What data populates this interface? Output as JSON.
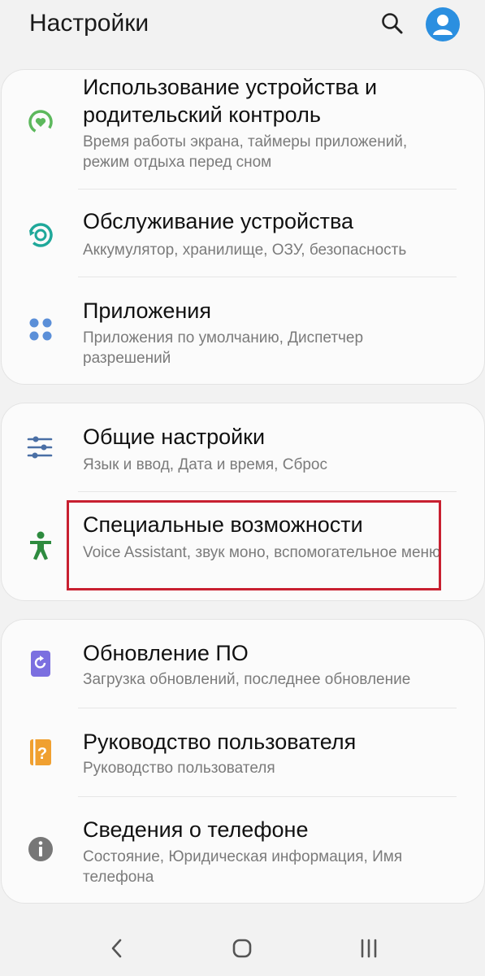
{
  "header": {
    "title": "Настройки"
  },
  "icons": {
    "search": "search-icon",
    "avatar": "account-icon"
  },
  "groups": [
    {
      "items": [
        {
          "title": "Использование устройства и родительский контроль",
          "subtitle": "Время работы экрана, таймеры приложений, режим отдыха перед сном",
          "icon": "digital-wellbeing-icon",
          "color": "#5cb85c"
        },
        {
          "title": "Обслуживание устройства",
          "subtitle": "Аккумулятор, хранилище, ОЗУ, безопасность",
          "icon": "device-care-icon",
          "color": "#1fa89a"
        },
        {
          "title": "Приложения",
          "subtitle": "Приложения по умолчанию, Диспетчер разрешений",
          "icon": "apps-grid-icon",
          "color": "#5b8fd8"
        }
      ]
    },
    {
      "items": [
        {
          "title": "Общие настройки",
          "subtitle": "Язык и ввод, Дата и время, Сброс",
          "icon": "sliders-icon",
          "color": "#4a6fa5"
        },
        {
          "title": "Специальные возможности",
          "subtitle": "Voice Assistant, звук моно, вспомогательное меню",
          "icon": "accessibility-icon",
          "color": "#2e8b3f"
        }
      ]
    },
    {
      "items": [
        {
          "title": "Обновление ПО",
          "subtitle": "Загрузка обновлений, последнее обновление",
          "icon": "software-update-icon",
          "color": "#7b6fe0"
        },
        {
          "title": "Руководство пользователя",
          "subtitle": "Руководство пользователя",
          "icon": "user-manual-icon",
          "color": "#f0a030"
        },
        {
          "title": "Сведения о телефоне",
          "subtitle": "Состояние, Юридическая информация, Имя телефона",
          "icon": "info-icon",
          "color": "#777777"
        }
      ]
    }
  ],
  "navigation": {
    "back": "back-icon",
    "home": "home-icon",
    "recents": "recents-icon"
  },
  "accent": "#c82030"
}
